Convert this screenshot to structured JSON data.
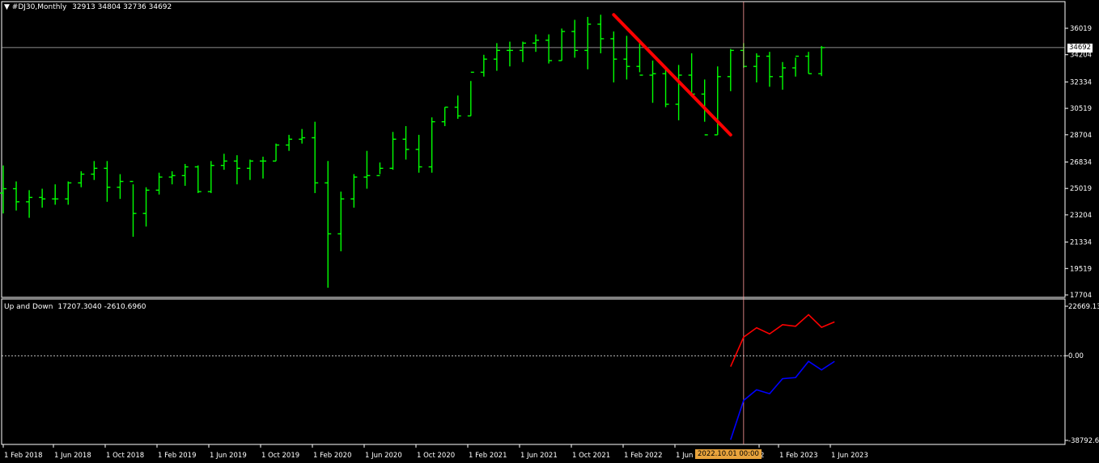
{
  "header": {
    "symbol": "#DJ30,Monthly",
    "ohlc": "32913 34804 32736 34692",
    "indicator_name": "Up and Down",
    "indicator_values": "17207.3040 -2610.6960"
  },
  "colors": {
    "background": "#000000",
    "bars": "#00ff00",
    "trendline": "#ff0000",
    "up_line": "#ff0000",
    "down_line": "#0000ff",
    "crosshair": "#ff9999",
    "grid": "#ffffff",
    "price_tag_bg": "#ffffff",
    "time_tag_bg": "#e8a33c"
  },
  "crosshair": {
    "time_label": "2022.10.01 00:00",
    "price_label": "34692"
  },
  "chart_data": [
    {
      "type": "bar",
      "title": "#DJ30,Monthly",
      "ylim": [
        17704,
        36019
      ],
      "price_ticks": [
        "36019",
        "34204",
        "32334",
        "30519",
        "28704",
        "26834",
        "25019",
        "23204",
        "21334",
        "19519",
        "17704"
      ],
      "x_tick_labels": [
        "1 Feb 2018",
        "1 Jun 2018",
        "1 Oct 2018",
        "1 Feb 2019",
        "1 Jun 2019",
        "1 Oct 2019",
        "1 Feb 2020",
        "1 Jun 2020",
        "1 Oct 2020",
        "1 Feb 2021",
        "1 Jun 2021",
        "1 Oct 2021",
        "1 Feb 2022",
        "1 Jun",
        "2",
        "1 Feb 2023",
        "1 Jun 2023"
      ],
      "current_price": 34692,
      "ohlc": [
        [
          24700,
          26600,
          23300,
          25000
        ],
        [
          25000,
          25500,
          23500,
          24100
        ],
        [
          24100,
          24900,
          23000,
          24400
        ],
        [
          24400,
          25000,
          23700,
          24300
        ],
        [
          24300,
          25300,
          23900,
          24300
        ],
        [
          24300,
          25500,
          23900,
          25400
        ],
        [
          25400,
          26200,
          25100,
          26000
        ],
        [
          26000,
          26900,
          25600,
          26400
        ],
        [
          26400,
          26900,
          24100,
          25100
        ],
        [
          25100,
          26000,
          24300,
          25500
        ],
        [
          25500,
          25300,
          21700,
          23300
        ],
        [
          23300,
          25100,
          22400,
          24900
        ],
        [
          24900,
          26100,
          24600,
          25800
        ],
        [
          25800,
          26200,
          25300,
          25900
        ],
        [
          25900,
          26700,
          25200,
          26500
        ],
        [
          26500,
          26600,
          24700,
          24800
        ],
        [
          24800,
          26900,
          24700,
          26600
        ],
        [
          26600,
          27400,
          26300,
          26900
        ],
        [
          26900,
          27300,
          25300,
          26400
        ],
        [
          26400,
          27000,
          25600,
          26900
        ],
        [
          26900,
          27200,
          25700,
          26900
        ],
        [
          26900,
          28100,
          26900,
          28000
        ],
        [
          28000,
          28700,
          27600,
          28400
        ],
        [
          28400,
          29100,
          28100,
          28500
        ],
        [
          28500,
          29600,
          24700,
          25400
        ],
        [
          25400,
          26900,
          18200,
          21900
        ],
        [
          21900,
          24800,
          20700,
          24300
        ],
        [
          24300,
          26000,
          23700,
          25800
        ],
        [
          25800,
          27600,
          25000,
          25900
        ],
        [
          25900,
          26800,
          26000,
          26400
        ],
        [
          26400,
          28900,
          26300,
          28400
        ],
        [
          28400,
          29300,
          27000,
          27700
        ],
        [
          27700,
          28700,
          26100,
          26500
        ],
        [
          26500,
          29900,
          26100,
          29600
        ],
        [
          29600,
          30600,
          29300,
          30600
        ],
        [
          30600,
          31400,
          29800,
          30000
        ],
        [
          30000,
          32400,
          30000,
          33000
        ],
        [
          33000,
          34200,
          32700,
          33900
        ],
        [
          33900,
          35000,
          33100,
          34500
        ],
        [
          34500,
          35100,
          33400,
          34500
        ],
        [
          34500,
          35100,
          33700,
          35000
        ],
        [
          35000,
          35600,
          34400,
          35200
        ],
        [
          35200,
          35600,
          33600,
          33800
        ],
        [
          33800,
          36000,
          33800,
          35800
        ],
        [
          35800,
          36600,
          34000,
          34500
        ],
        [
          34500,
          36800,
          33200,
          36300
        ],
        [
          36300,
          36950,
          34300,
          35300
        ],
        [
          35300,
          35800,
          32300,
          33900
        ],
        [
          33900,
          35500,
          32500,
          33400
        ],
        [
          33400,
          35100,
          33000,
          32800
        ],
        [
          32800,
          33800,
          30900,
          32900
        ],
        [
          32900,
          33300,
          30600,
          30800
        ],
        [
          30800,
          33500,
          29700,
          32800
        ],
        [
          32800,
          34300,
          31600,
          31500
        ],
        [
          31500,
          32500,
          29600,
          28700
        ],
        [
          28700,
          33400,
          28700,
          32700
        ],
        [
          32700,
          34600,
          31700,
          34500
        ],
        [
          34500,
          35000,
          33300,
          33400
        ],
        [
          33400,
          34300,
          32300,
          34100
        ],
        [
          34100,
          34400,
          32000,
          32700
        ],
        [
          32700,
          33700,
          31800,
          33300
        ],
        [
          33300,
          34000,
          32700,
          34100
        ],
        [
          34100,
          34400,
          32900,
          32900
        ],
        [
          32900,
          34804,
          32736,
          34692
        ]
      ],
      "trendline": {
        "from": {
          "date": "2021-12",
          "price": 36950
        },
        "to": {
          "date": "2022-09",
          "price": 28700
        }
      }
    },
    {
      "type": "line",
      "title": "Up and Down",
      "ylim": [
        -38792.6,
        22669.13
      ],
      "y_tick_labels": [
        "22669.13",
        "0.00",
        "-38792.6"
      ],
      "zero_line": 0,
      "series": [
        {
          "name": "Up",
          "values": [
            -5000,
            8500,
            12800,
            10000,
            14200,
            13500,
            18800,
            13000,
            15500
          ]
        },
        {
          "name": "Down",
          "values": [
            -38500,
            -20500,
            -15600,
            -17400,
            -10500,
            -10000,
            -2600,
            -6500,
            -2600
          ]
        }
      ],
      "x_start_bar": 56
    }
  ]
}
